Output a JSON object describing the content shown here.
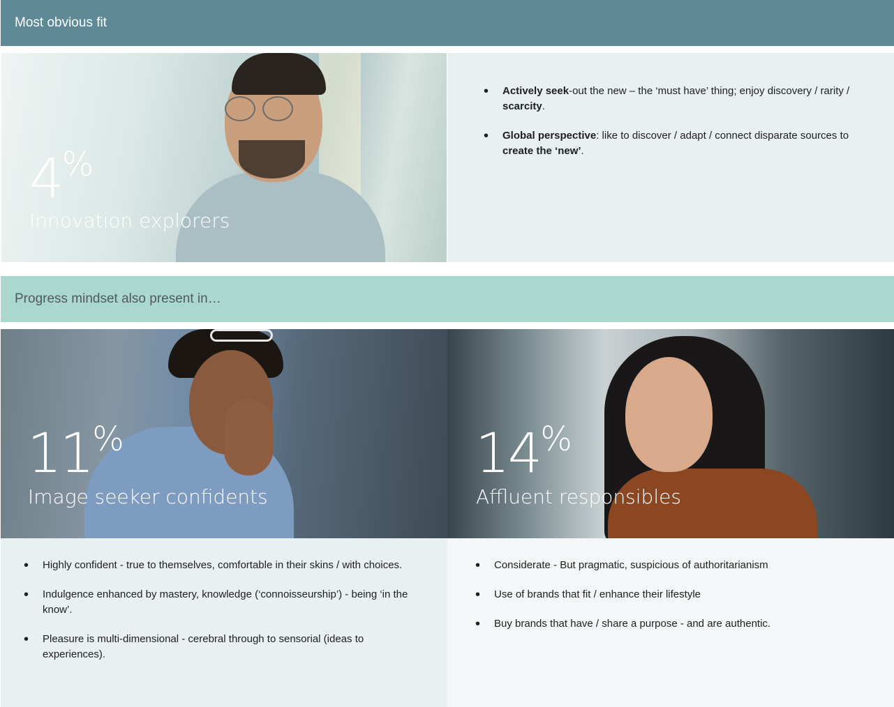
{
  "top_banner": {
    "title": "Most obvious fit"
  },
  "mid_banner": {
    "title": "Progress mindset also present in…"
  },
  "segments": [
    {
      "number": "4",
      "percent_sign": "%",
      "label": "Innovation explorers",
      "bullets": [
        {
          "bold1": "Actively seek",
          "text1": "-out the new – the ‘must have’ thing; enjoy discovery / rarity / ",
          "bold2": "scarcity",
          "text2": "."
        },
        {
          "bold1": "Global perspective",
          "text1": ": like to discover / adapt / connect disparate sources to ",
          "bold2": "create the ‘new’",
          "text2": "."
        }
      ]
    },
    {
      "number": "11",
      "percent_sign": "%",
      "label": "Image seeker confidents",
      "bullets": [
        "Highly confident  - true to themselves, comfortable in their skins / with choices.",
        "Indulgence enhanced by mastery, knowledge (‘connoisseurship’) - being ‘in the know’.",
        "Pleasure is multi-dimensional - cerebral through to sensorial (ideas to experiences)."
      ]
    },
    {
      "number": "14",
      "percent_sign": "%",
      "label": "Affluent responsibles",
      "bullets": [
        "Considerate - But pragmatic, suspicious of authoritarianism",
        "Use of brands that fit / enhance their lifestyle",
        "Buy brands that have / share a purpose - and are authentic."
      ]
    }
  ]
}
